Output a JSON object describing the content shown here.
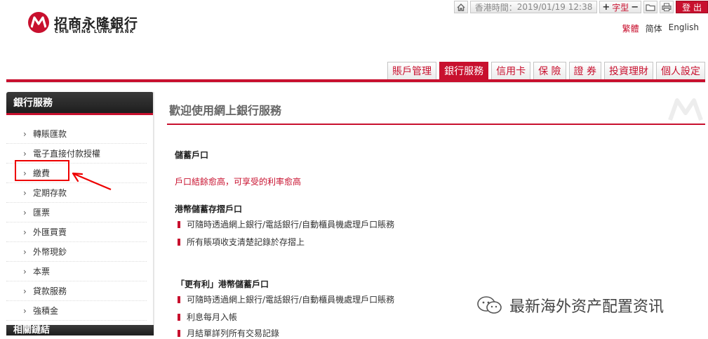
{
  "topbar": {
    "time_label": "香港時間：",
    "time_value": "2019/01/19 12:38",
    "font_label": "字型",
    "logout_label": "登 出"
  },
  "logo": {
    "name_cn": "招商永隆銀行",
    "name_en": "CMB WING LUNG BANK"
  },
  "language": {
    "items": [
      "繁體",
      "简体",
      "English"
    ],
    "active_color": "#c8102e"
  },
  "nav": {
    "tabs": [
      "賬戶管理",
      "銀行服務",
      "信用卡",
      "保 險",
      "證 券",
      "投資理財",
      "個人設定"
    ],
    "active_index": 1
  },
  "sidebar": {
    "title": "銀行服務",
    "items": [
      "轉賬匯款",
      "電子直接付款授權",
      "繳費",
      "定期存款",
      "匯票",
      "外匯買賣",
      "外幣現鈔",
      "本票",
      "貸款服務",
      "強積金"
    ],
    "highlighted_index": 2,
    "next_section_title": "相關鏈結"
  },
  "content": {
    "title": "歡迎使用網上銀行服務",
    "section_heading": "儲蓄戶口",
    "promo": "戶口結餘愈高，可享受的利率愈高",
    "group1": {
      "heading": "港幣儲蓄存摺戶口",
      "bullets": [
        "可隨時透過網上銀行/電話銀行/自動櫃員機處理戶口賬務",
        "所有賬項收支清楚記錄於存摺上"
      ]
    },
    "group2": {
      "heading": "「更有利」港幣儲蓄戶口",
      "bullets": [
        "可隨時透過網上銀行/電話銀行/自動櫃員機處理戶口賬務",
        "利息每月入帳",
        "月結單詳列所有交易記錄"
      ]
    }
  },
  "watermark": {
    "text": "最新海外资产配置资讯"
  },
  "colors": {
    "brand_red": "#c8102e",
    "sidebar_header": "#2a2a2a"
  }
}
